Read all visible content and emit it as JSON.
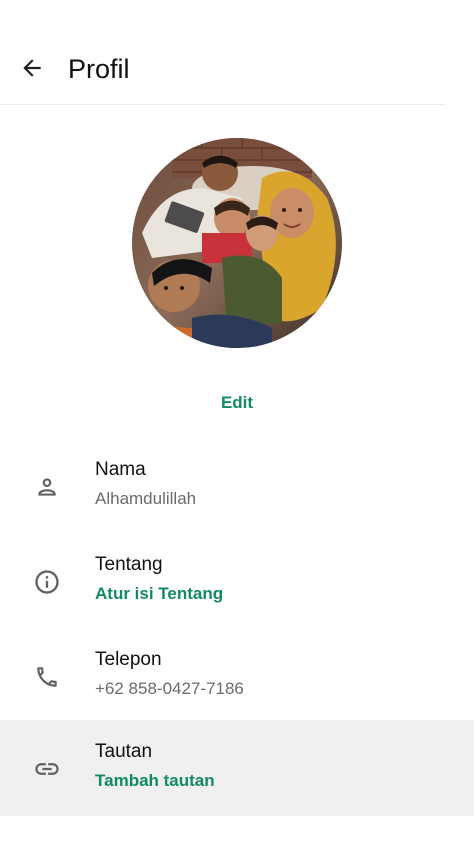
{
  "header": {
    "title": "Profil",
    "back_icon": "arrow-left-icon"
  },
  "avatar": {
    "description_icon": "profile-photo",
    "edit_label": "Edit"
  },
  "rows": [
    {
      "icon": "person-icon",
      "label": "Nama",
      "value": "Alhamdulillah"
    },
    {
      "icon": "info-icon",
      "label": "Tentang",
      "value": "Atur isi Tentang"
    },
    {
      "icon": "phone-icon",
      "label": "Telepon",
      "value": "+62 858-0427-7186"
    },
    {
      "icon": "link-icon",
      "label": "Tautan",
      "value": "Tambah tautan"
    }
  ],
  "colors": {
    "accent": "#128c5e",
    "text_primary": "#111111",
    "text_secondary": "#6b6b6b",
    "icon": "#5f6368",
    "highlight_row": "#f0f0f0"
  }
}
